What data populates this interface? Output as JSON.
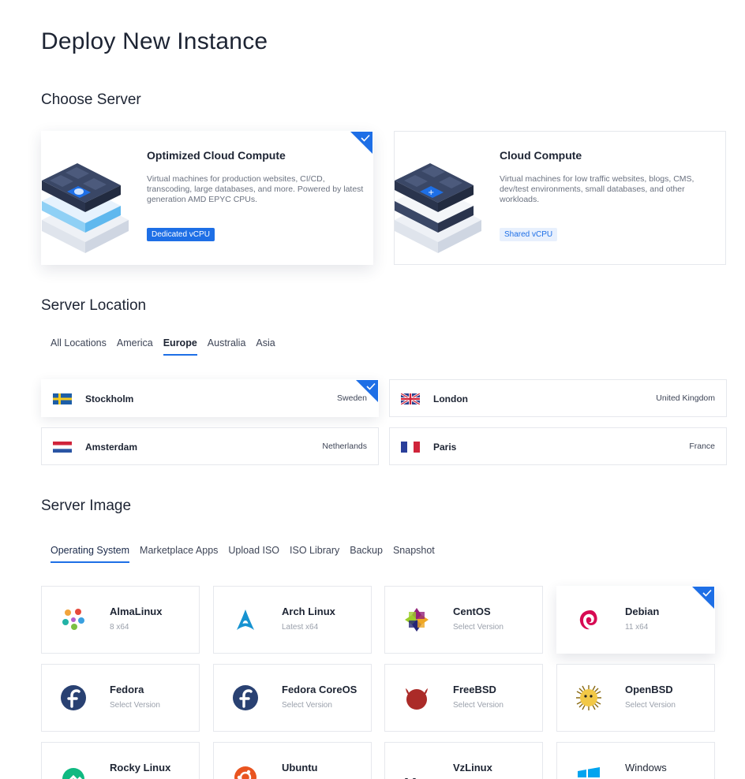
{
  "page": {
    "title": "Deploy New Instance"
  },
  "server": {
    "section_title": "Choose Server",
    "cards": [
      {
        "title": "Optimized Cloud Compute",
        "description": "Virtual machines for production websites, CI/CD, transcoding, large databases, and more. Powered by latest generation AMD EPYC CPUs.",
        "tag": "Dedicated vCPU",
        "selected": true
      },
      {
        "title": "Cloud Compute",
        "description": "Virtual machines for low traffic websites, blogs, CMS, dev/test environments, small databases, and other workloads.",
        "tag": "Shared vCPU",
        "selected": false
      }
    ]
  },
  "location": {
    "section_title": "Server Location",
    "tabs": [
      "All Locations",
      "America",
      "Europe",
      "Australia",
      "Asia"
    ],
    "active_tab": "Europe",
    "items": [
      {
        "city": "Stockholm",
        "country": "Sweden",
        "flag": "sweden-flag",
        "selected": true
      },
      {
        "city": "London",
        "country": "United Kingdom",
        "flag": "uk-flag",
        "selected": false
      },
      {
        "city": "Amsterdam",
        "country": "Netherlands",
        "flag": "netherlands-flag",
        "selected": false
      },
      {
        "city": "Paris",
        "country": "France",
        "flag": "france-flag",
        "selected": false
      }
    ]
  },
  "image": {
    "section_title": "Server Image",
    "tabs": [
      "Operating System",
      "Marketplace Apps",
      "Upload ISO",
      "ISO Library",
      "Backup",
      "Snapshot"
    ],
    "active_tab": "Operating System",
    "os": [
      {
        "name": "AlmaLinux",
        "sub": "8  x64",
        "icon": "almalinux-icon"
      },
      {
        "name": "Arch Linux",
        "sub": "Latest  x64",
        "icon": "archlinux-icon"
      },
      {
        "name": "CentOS",
        "sub": "Select Version",
        "icon": "centos-icon"
      },
      {
        "name": "Debian",
        "sub": "11  x64",
        "icon": "debian-icon",
        "selected": true
      },
      {
        "name": "Fedora",
        "sub": "Select Version",
        "icon": "fedora-icon"
      },
      {
        "name": "Fedora CoreOS",
        "sub": "Select Version",
        "icon": "fedora-coreos-icon"
      },
      {
        "name": "FreeBSD",
        "sub": "Select Version",
        "icon": "freebsd-icon"
      },
      {
        "name": "OpenBSD",
        "sub": "Select Version",
        "icon": "openbsd-icon"
      },
      {
        "name": "Rocky Linux",
        "sub": "",
        "icon": "rockylinux-icon"
      },
      {
        "name": "Ubuntu",
        "sub": "",
        "icon": "ubuntu-icon"
      },
      {
        "name": "VzLinux",
        "sub": "",
        "icon": "vzlinux-icon"
      },
      {
        "name": "Windows",
        "sub": "",
        "icon": "windows-icon"
      }
    ]
  },
  "colors": {
    "accent": "#1e6fe6",
    "text": "#1d2433",
    "muted": "#9aa0ab",
    "border": "#e6e8ed"
  }
}
